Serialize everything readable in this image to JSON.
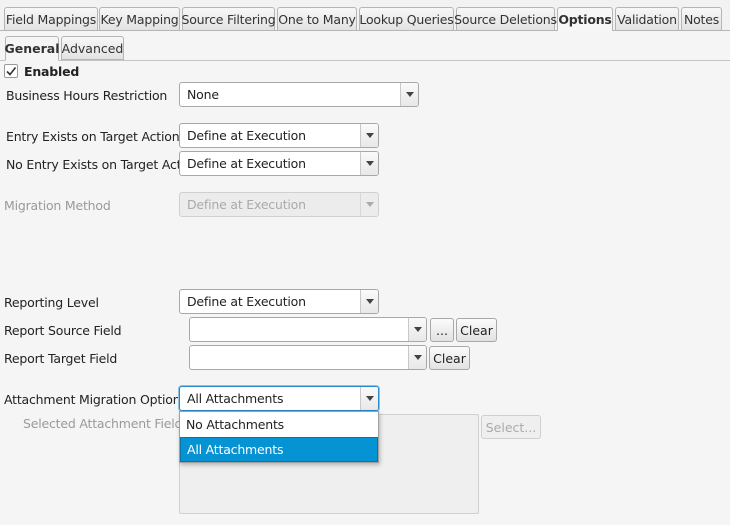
{
  "tabs": [
    {
      "label": "Field Mappings"
    },
    {
      "label": "Key Mapping"
    },
    {
      "label": "Source Filtering"
    },
    {
      "label": "One to Many"
    },
    {
      "label": "Lookup Queries"
    },
    {
      "label": "Source Deletions"
    },
    {
      "label": "Options"
    },
    {
      "label": "Validation"
    },
    {
      "label": "Notes"
    }
  ],
  "subtabs": [
    {
      "label": "General"
    },
    {
      "label": "Advanced"
    }
  ],
  "enabled": {
    "label": "Enabled",
    "checked": true
  },
  "fields": {
    "business_hours": {
      "label": "Business Hours Restriction",
      "value": "None"
    },
    "entry_exists": {
      "label": "Entry Exists on Target Action",
      "value": "Define at Execution"
    },
    "no_entry_exists": {
      "label": "No Entry Exists on Target Action",
      "value": "Define at Execution"
    },
    "migration_method": {
      "label": "Migration Method",
      "value": "Define at Execution"
    },
    "reporting_level": {
      "label": "Reporting Level",
      "value": "Define at Execution"
    },
    "report_source": {
      "label": "Report Source Field",
      "value": "",
      "browse_label": "...",
      "clear_label": "Clear"
    },
    "report_target": {
      "label": "Report Target Field",
      "value": "",
      "clear_label": "Clear"
    },
    "attachment_option": {
      "label": "Attachment Migration Option",
      "value": "All Attachments"
    },
    "selected_attachment_fields": {
      "label": "Selected Attachment Fields",
      "select_label": "Select..."
    }
  },
  "dropdown": {
    "options": [
      "No Attachments",
      "All Attachments"
    ],
    "selected": "All Attachments"
  }
}
